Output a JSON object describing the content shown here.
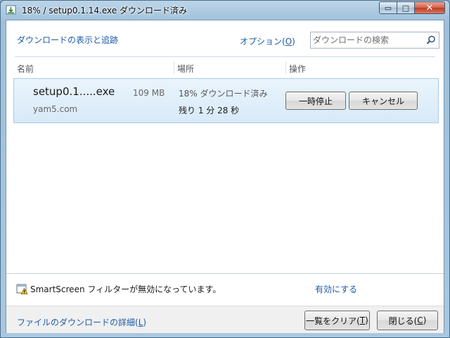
{
  "window": {
    "title": "18% / setup0.1.14.exe ダウンロード済み",
    "controls": {
      "minimize": "▭",
      "maximize": "□",
      "close": "✕"
    }
  },
  "header": {
    "title": "ダウンロードの表示と追跡",
    "options_link": "オプション(",
    "options_key": "O",
    "options_close": ")",
    "search_placeholder": "ダウンロードの検索"
  },
  "columns": [
    "名前",
    "場所",
    "操作"
  ],
  "downloads": [
    {
      "filename": "setup0.1.....exe",
      "size": "109 MB",
      "site": "yam5.com",
      "status": "18% ダウンロード済み",
      "progress_percent": 18,
      "remaining": "残り 1 分 28 秒",
      "pause_label": "一時停止",
      "cancel_label": "キャンセル"
    }
  ],
  "smartscreen": {
    "message": "SmartScreen フィルターが無効になっています。",
    "enable_link": "有効にする"
  },
  "footer": {
    "details_link": "ファイルのダウンロードの詳細(",
    "details_key": "L",
    "details_close": ")",
    "clear_label": "一覧をクリア(",
    "clear_key": "T",
    "clear_close": ")",
    "close_label": "閉じる(",
    "close_key": "C",
    "close_close": ")"
  },
  "colors": {
    "link": "#1e5aa6",
    "row_highlight": "#d7eaf8",
    "titlebar": "#bcd4e8"
  },
  "icons": {
    "title": "download-window-icon",
    "search": "search-icon",
    "smartscreen": "shield-warning-icon"
  }
}
